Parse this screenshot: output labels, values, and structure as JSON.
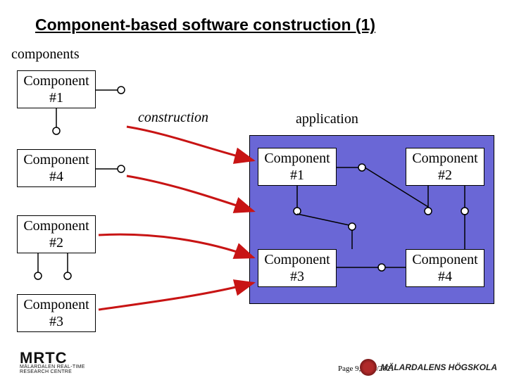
{
  "title": "Component-based software construction (1)",
  "labels": {
    "components": "components",
    "construction": "construction",
    "application": "application"
  },
  "left_components": [
    {
      "name": "Component\n#1"
    },
    {
      "name": "Component\n#4"
    },
    {
      "name": "Component\n#2"
    },
    {
      "name": "Component\n#3"
    }
  ],
  "app_components": [
    {
      "name": "Component\n#1"
    },
    {
      "name": "Component\n#2"
    },
    {
      "name": "Component\n#3"
    },
    {
      "name": "Component\n#4"
    }
  ],
  "footer": {
    "page": "Page 9, 6/14/2021",
    "left_logo_big": "MRTC",
    "left_logo_small": "MÄLARDALEN REAL-TIME\nRESEARCH CENTRE",
    "right_logo": "MÄLARDALENS HÖGSKOLA"
  },
  "colors": {
    "app_panel": "#6a67d6",
    "arrow": "#c81414"
  }
}
